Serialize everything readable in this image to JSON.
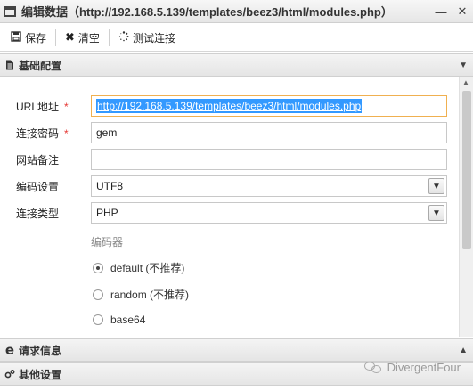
{
  "window": {
    "title": "编辑数据（http://192.168.5.139/templates/beez3/html/modules.php）",
    "minimize_icon": "minimize-icon",
    "close_icon": "close-icon"
  },
  "toolbar": {
    "save_label": "保存",
    "clear_label": "清空",
    "test_label": "测试连接"
  },
  "sections": {
    "basic": {
      "label": "基础配置",
      "icon": "document-icon"
    },
    "request": {
      "label": "请求信息",
      "icon": "ie-icon"
    },
    "other": {
      "label": "其他设置",
      "icon": "gears-icon"
    }
  },
  "form": {
    "url_label": "URL地址",
    "url_value": "http://192.168.5.139/templates/beez3/html/modules.php",
    "password_label": "连接密码",
    "password_value": "gem",
    "note_label": "网站备注",
    "note_value": "",
    "encoding_label": "编码设置",
    "encoding_value": "UTF8",
    "type_label": "连接类型",
    "type_value": "PHP",
    "required_mark": "*"
  },
  "encoder": {
    "title": "编码器",
    "options": [
      "default (不推荐)",
      "random (不推荐)",
      "base64"
    ],
    "selected_index": 0
  },
  "watermark": {
    "text": "DivergentFour"
  }
}
